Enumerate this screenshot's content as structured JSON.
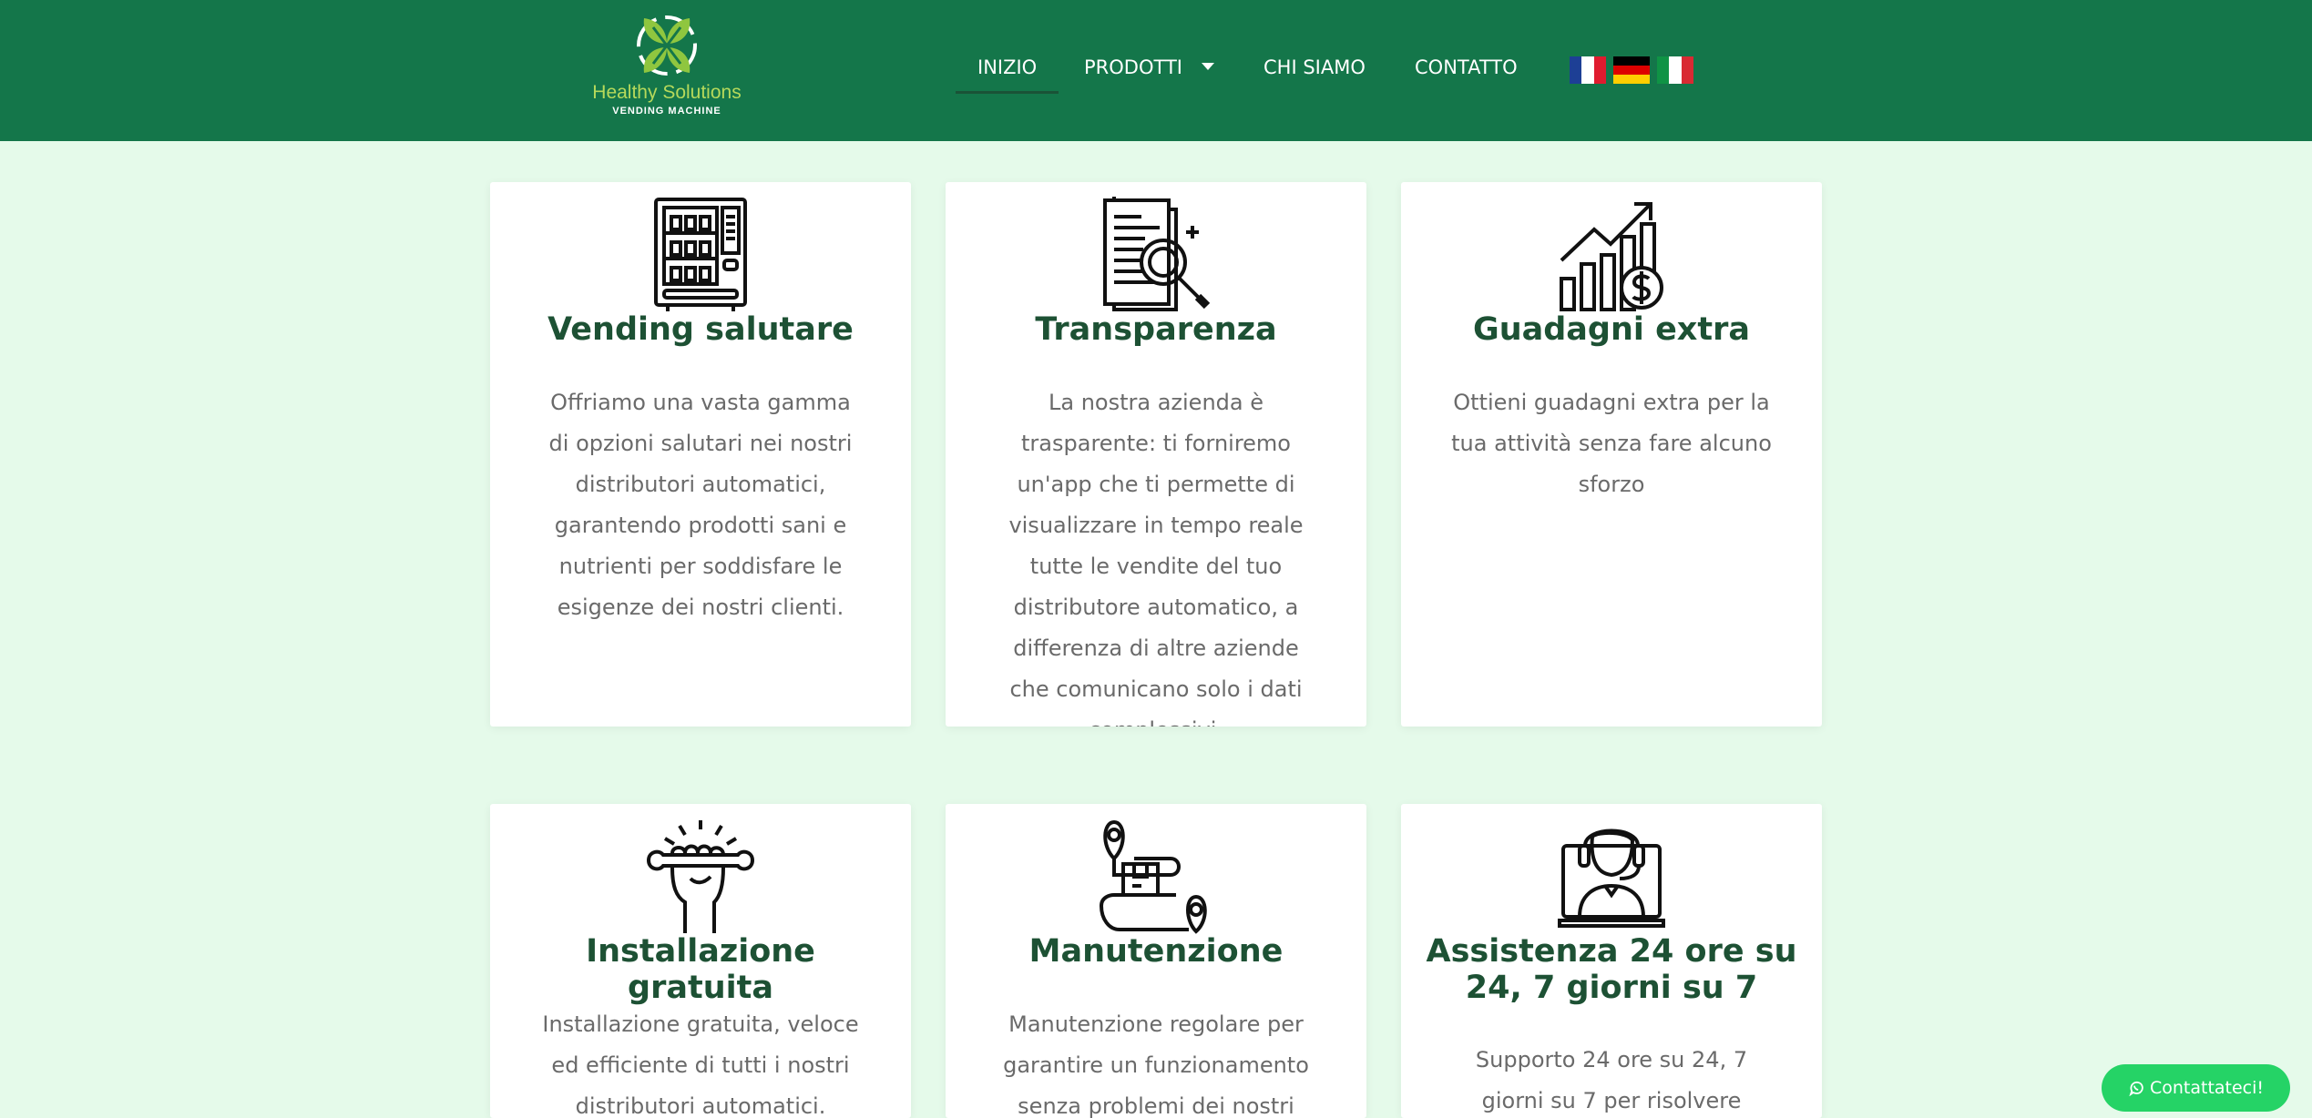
{
  "header": {
    "logo": {
      "line1": "Healthy Solutions",
      "line2": "VENDING MACHINE"
    },
    "nav": [
      {
        "label": "INIZIO",
        "active": true
      },
      {
        "label": "PRODOTTI",
        "has_dropdown": true
      },
      {
        "label": "CHI SIAMO"
      },
      {
        "label": "CONTATTO"
      }
    ],
    "flags": [
      {
        "name": "french-flag-icon",
        "colors": [
          "#1d3f95",
          "#ffffff",
          "#e01b2f"
        ]
      },
      {
        "name": "german-flag-icon",
        "colors": [
          "#000000",
          "#dd0000",
          "#ffce00"
        ]
      },
      {
        "name": "italian-flag-icon",
        "colors": [
          "#0f9345",
          "#ffffff",
          "#d92a33"
        ]
      }
    ]
  },
  "cards": [
    {
      "icon": "vending-machine-icon",
      "title": "Vending salutare",
      "text": "Offriamo una vasta gamma di opzioni salutari nei nostri distributori automatici, garantendo prodotti sani e nutrienti per soddisfare le esigenze dei nostri clienti."
    },
    {
      "icon": "document-magnifier-icon",
      "title": "Transparenza",
      "text": "La nostra azienda è trasparente: ti forniremo un'app che ti permette di visualizzare in tempo reale tutte le vendite del tuo distributore automatico, a differenza di altre aziende che comunicano solo i dati complessivi."
    },
    {
      "icon": "growth-chart-dollar-icon",
      "title": "Guadagni extra",
      "text": "Ottieni guadagni extra per la tua attività senza fare alcuno sforzo"
    },
    {
      "icon": "hand-wrench-icon",
      "title": "Installazione gratuita",
      "text": "Installazione gratuita, veloce ed efficiente di tutti i nostri distributori automatici."
    },
    {
      "icon": "delivery-box-pin-icon",
      "title": "Manutenzione",
      "text": "Manutenzione regolare per garantire un funzionamento senza problemi dei nostri"
    },
    {
      "icon": "support-agent-icon",
      "title": "Assistenza 24 ore su 24, 7 giorni su 7",
      "text": "Supporto 24 ore su 24, 7 giorni su 7 per risolvere qualsiasi"
    }
  ],
  "whatsapp_button": {
    "label": "Contattateci!",
    "color": "#25d366"
  },
  "colors": {
    "header": "#14764a",
    "page_background": "#e5faea",
    "card_title": "#1d5134",
    "card_text": "#6a6a6a"
  }
}
